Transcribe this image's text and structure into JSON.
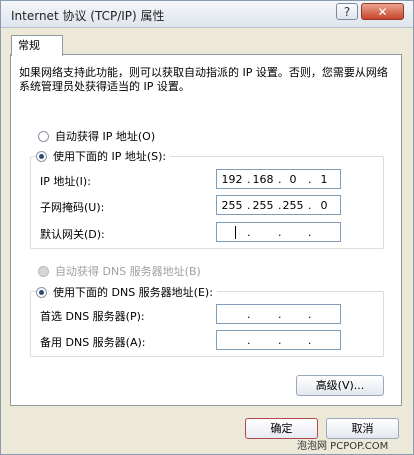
{
  "window": {
    "title": "Internet 协议 (TCP/IP) 属性",
    "help_label": "?",
    "close_label": "✕"
  },
  "tab": {
    "label": "常规"
  },
  "description": "如果网络支持此功能，则可以获取自动指派的 IP 设置。否则，您需要从网络系统管理员处获得适当的 IP 设置。",
  "ip_section": {
    "auto_label": "自动获得 IP 地址(O)",
    "manual_label": "使用下面的 IP 地址(S):",
    "ip_label": "IP 地址(I):",
    "ip_octets": [
      "192",
      "168",
      "0",
      "1"
    ],
    "mask_label": "子网掩码(U):",
    "mask_octets": [
      "255",
      "255",
      "255",
      "0"
    ],
    "gateway_label": "默认网关(D):",
    "gateway_octets": [
      "",
      "",
      "",
      ""
    ]
  },
  "dns_section": {
    "auto_label": "自动获得 DNS 服务器地址(B)",
    "manual_label": "使用下面的 DNS 服务器地址(E):",
    "preferred_label": "首选 DNS 服务器(P):",
    "alternate_label": "备用 DNS 服务器(A):"
  },
  "buttons": {
    "advanced": "高级(V)...",
    "ok": "确定",
    "cancel": "取消"
  },
  "watermark": "泡泡网 PCPOP.COM"
}
